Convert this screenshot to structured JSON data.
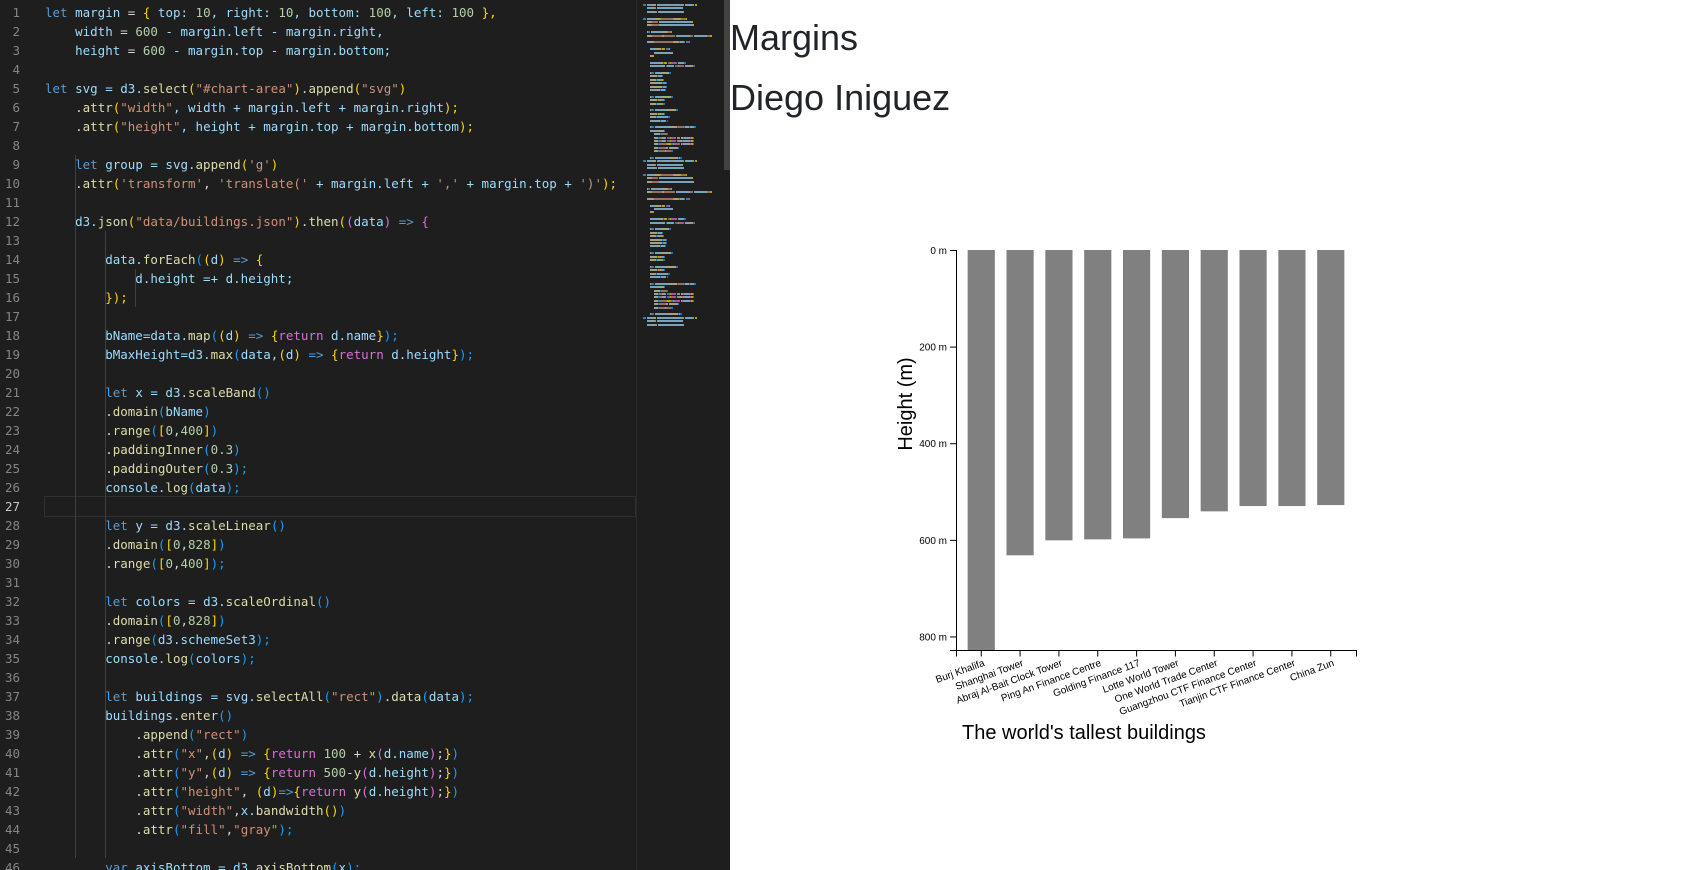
{
  "editor": {
    "active_line": 27,
    "lines": [
      [
        [
          "let",
          "kw"
        ],
        [
          " margin ",
          "vr"
        ],
        [
          "= ",
          "pn"
        ],
        [
          "{",
          "br1"
        ],
        [
          " top: ",
          "vr"
        ],
        [
          "10",
          "nm"
        ],
        [
          ", right: ",
          "vr"
        ],
        [
          "10",
          "nm"
        ],
        [
          ", bottom: ",
          "vr"
        ],
        [
          "100",
          "nm"
        ],
        [
          ", left: ",
          "vr"
        ],
        [
          "100",
          "nm"
        ],
        [
          " },",
          "br1"
        ]
      ],
      [
        [
          "    width ",
          "vr"
        ],
        [
          "= ",
          "pn"
        ],
        [
          "600",
          "nm"
        ],
        [
          " - margin.left - margin.right,",
          "vr"
        ]
      ],
      [
        [
          "    height ",
          "vr"
        ],
        [
          "= ",
          "pn"
        ],
        [
          "600",
          "nm"
        ],
        [
          " - margin.top - margin.bottom;",
          "vr"
        ]
      ],
      [],
      [
        [
          "let",
          "kw"
        ],
        [
          " svg ",
          "vr"
        ],
        [
          "= d3.",
          "vr"
        ],
        [
          "select",
          "fn"
        ],
        [
          "(",
          "br1"
        ],
        [
          "\"#chart-area\"",
          "st"
        ],
        [
          ")",
          "br1"
        ],
        [
          ".",
          "pn"
        ],
        [
          "append",
          "fn"
        ],
        [
          "(",
          "br1"
        ],
        [
          "\"svg\"",
          "st"
        ],
        [
          ")",
          "br1"
        ]
      ],
      [
        [
          "    .",
          "pn"
        ],
        [
          "attr",
          "fn"
        ],
        [
          "(",
          "br1"
        ],
        [
          "\"width\"",
          "st"
        ],
        [
          ", width + margin.left + margin.right",
          "vr"
        ],
        [
          ");",
          "br1"
        ]
      ],
      [
        [
          "    .",
          "pn"
        ],
        [
          "attr",
          "fn"
        ],
        [
          "(",
          "br1"
        ],
        [
          "\"height\"",
          "st"
        ],
        [
          ", height + margin.top + margin.bottom",
          "vr"
        ],
        [
          ");",
          "br1"
        ]
      ],
      [],
      [
        [
          "    ",
          "pn"
        ],
        [
          "let",
          "kw"
        ],
        [
          " group ",
          "vr"
        ],
        [
          "= svg.",
          "vr"
        ],
        [
          "append",
          "fn"
        ],
        [
          "(",
          "br1"
        ],
        [
          "'g'",
          "st"
        ],
        [
          ")",
          "br1"
        ]
      ],
      [
        [
          "    .",
          "pn"
        ],
        [
          "attr",
          "fn"
        ],
        [
          "(",
          "br1"
        ],
        [
          "'transform'",
          "st"
        ],
        [
          ", ",
          "pn"
        ],
        [
          "'translate('",
          "st"
        ],
        [
          " + margin.left + ",
          "vr"
        ],
        [
          "','",
          "st"
        ],
        [
          " + margin.top + ",
          "vr"
        ],
        [
          "')'",
          "st"
        ],
        [
          ");",
          "br1"
        ]
      ],
      [],
      [
        [
          "    d3.",
          "vr"
        ],
        [
          "json",
          "fn"
        ],
        [
          "(",
          "br1"
        ],
        [
          "\"data/buildings.json\"",
          "st"
        ],
        [
          ")",
          "br1"
        ],
        [
          ".",
          "pn"
        ],
        [
          "then",
          "fn"
        ],
        [
          "(",
          "br1"
        ],
        [
          "(",
          "br2"
        ],
        [
          "data",
          "vr"
        ],
        [
          ")",
          "br2"
        ],
        [
          " => ",
          "ar"
        ],
        [
          "{",
          "br2"
        ]
      ],
      [],
      [
        [
          "        data.",
          "vr"
        ],
        [
          "forEach",
          "fn"
        ],
        [
          "(",
          "br3"
        ],
        [
          "(",
          "br1"
        ],
        [
          "d",
          "vr"
        ],
        [
          ")",
          "br1"
        ],
        [
          " => ",
          "ar"
        ],
        [
          "{",
          "br1"
        ]
      ],
      [
        [
          "            d.height =+ d.height;",
          "vr"
        ]
      ],
      [
        [
          "        ",
          "pn"
        ],
        [
          "});",
          "br1"
        ]
      ],
      [],
      [
        [
          "        bName",
          "vr"
        ],
        [
          "=data.",
          "vr"
        ],
        [
          "map",
          "fn"
        ],
        [
          "(",
          "br3"
        ],
        [
          "(",
          "br1"
        ],
        [
          "d",
          "vr"
        ],
        [
          ")",
          "br1"
        ],
        [
          " => ",
          "ar"
        ],
        [
          "{",
          "br1"
        ],
        [
          "return",
          "br2"
        ],
        [
          " d.name",
          "vr"
        ],
        [
          "}",
          "br1"
        ],
        [
          ");",
          "br3"
        ]
      ],
      [
        [
          "        bMaxHeight",
          "vr"
        ],
        [
          "=d3.",
          "vr"
        ],
        [
          "max",
          "fn"
        ],
        [
          "(",
          "br3"
        ],
        [
          "data,",
          "vr"
        ],
        [
          "(",
          "br1"
        ],
        [
          "d",
          "vr"
        ],
        [
          ")",
          "br1"
        ],
        [
          " => ",
          "ar"
        ],
        [
          "{",
          "br1"
        ],
        [
          "return",
          "br2"
        ],
        [
          " d.height",
          "vr"
        ],
        [
          "}",
          "br1"
        ],
        [
          ");",
          "br3"
        ]
      ],
      [],
      [
        [
          "        ",
          "pn"
        ],
        [
          "let",
          "kw"
        ],
        [
          " x ",
          "vr"
        ],
        [
          "= d3.",
          "vr"
        ],
        [
          "scaleBand",
          "fn"
        ],
        [
          "()",
          "br3"
        ]
      ],
      [
        [
          "        .",
          "pn"
        ],
        [
          "domain",
          "fn"
        ],
        [
          "(",
          "br3"
        ],
        [
          "bName",
          "vr"
        ],
        [
          ")",
          "br3"
        ]
      ],
      [
        [
          "        .",
          "pn"
        ],
        [
          "range",
          "fn"
        ],
        [
          "(",
          "br3"
        ],
        [
          "[",
          "br1"
        ],
        [
          "0",
          "nm"
        ],
        [
          ",",
          "pn"
        ],
        [
          "400",
          "nm"
        ],
        [
          "]",
          "br1"
        ],
        [
          ")",
          "br3"
        ]
      ],
      [
        [
          "        .",
          "pn"
        ],
        [
          "paddingInner",
          "fn"
        ],
        [
          "(",
          "br3"
        ],
        [
          "0.3",
          "nm"
        ],
        [
          ")",
          "br3"
        ]
      ],
      [
        [
          "        .",
          "pn"
        ],
        [
          "paddingOuter",
          "fn"
        ],
        [
          "(",
          "br3"
        ],
        [
          "0.3",
          "nm"
        ],
        [
          ");",
          "br3"
        ]
      ],
      [
        [
          "        console.",
          "vr"
        ],
        [
          "log",
          "fn"
        ],
        [
          "(",
          "br3"
        ],
        [
          "data",
          "vr"
        ],
        [
          ");",
          "br3"
        ]
      ],
      [],
      [
        [
          "        ",
          "pn"
        ],
        [
          "let",
          "kw"
        ],
        [
          " y ",
          "vr"
        ],
        [
          "= d3.",
          "vr"
        ],
        [
          "scaleLinear",
          "fn"
        ],
        [
          "()",
          "br3"
        ]
      ],
      [
        [
          "        .",
          "pn"
        ],
        [
          "domain",
          "fn"
        ],
        [
          "(",
          "br3"
        ],
        [
          "[",
          "br1"
        ],
        [
          "0",
          "nm"
        ],
        [
          ",",
          "pn"
        ],
        [
          "828",
          "nm"
        ],
        [
          "]",
          "br1"
        ],
        [
          ")",
          "br3"
        ]
      ],
      [
        [
          "        .",
          "pn"
        ],
        [
          "range",
          "fn"
        ],
        [
          "(",
          "br3"
        ],
        [
          "[",
          "br1"
        ],
        [
          "0",
          "nm"
        ],
        [
          ",",
          "pn"
        ],
        [
          "400",
          "nm"
        ],
        [
          "]",
          "br1"
        ],
        [
          ");",
          "br3"
        ]
      ],
      [],
      [
        [
          "        ",
          "pn"
        ],
        [
          "let",
          "kw"
        ],
        [
          " colors ",
          "vr"
        ],
        [
          "= d3.",
          "vr"
        ],
        [
          "scaleOrdinal",
          "fn"
        ],
        [
          "()",
          "br3"
        ]
      ],
      [
        [
          "        .",
          "pn"
        ],
        [
          "domain",
          "fn"
        ],
        [
          "(",
          "br3"
        ],
        [
          "[",
          "br1"
        ],
        [
          "0",
          "nm"
        ],
        [
          ",",
          "pn"
        ],
        [
          "828",
          "nm"
        ],
        [
          "]",
          "br1"
        ],
        [
          ")",
          "br3"
        ]
      ],
      [
        [
          "        .",
          "pn"
        ],
        [
          "range",
          "fn"
        ],
        [
          "(",
          "br3"
        ],
        [
          "d3.schemeSet3",
          "vr"
        ],
        [
          ");",
          "br3"
        ]
      ],
      [
        [
          "        console.",
          "vr"
        ],
        [
          "log",
          "fn"
        ],
        [
          "(",
          "br3"
        ],
        [
          "colors",
          "vr"
        ],
        [
          ");",
          "br3"
        ]
      ],
      [],
      [
        [
          "        ",
          "pn"
        ],
        [
          "let",
          "kw"
        ],
        [
          " buildings ",
          "vr"
        ],
        [
          "= svg.",
          "vr"
        ],
        [
          "selectAll",
          "fn"
        ],
        [
          "(",
          "br3"
        ],
        [
          "\"rect\"",
          "st"
        ],
        [
          ")",
          "br3"
        ],
        [
          ".",
          "pn"
        ],
        [
          "data",
          "fn"
        ],
        [
          "(",
          "br3"
        ],
        [
          "data",
          "vr"
        ],
        [
          ");",
          "br3"
        ]
      ],
      [
        [
          "        buildings.",
          "vr"
        ],
        [
          "enter",
          "fn"
        ],
        [
          "()",
          "br3"
        ]
      ],
      [
        [
          "            .",
          "pn"
        ],
        [
          "append",
          "fn"
        ],
        [
          "(",
          "br3"
        ],
        [
          "\"rect\"",
          "st"
        ],
        [
          ")",
          "br3"
        ]
      ],
      [
        [
          "            .",
          "pn"
        ],
        [
          "attr",
          "fn"
        ],
        [
          "(",
          "br3"
        ],
        [
          "\"x\"",
          "st"
        ],
        [
          ",",
          "pn"
        ],
        [
          "(",
          "br1"
        ],
        [
          "d",
          "vr"
        ],
        [
          ")",
          "br1"
        ],
        [
          " => ",
          "ar"
        ],
        [
          "{",
          "br1"
        ],
        [
          "return",
          "br2"
        ],
        [
          " 100",
          "nm"
        ],
        [
          " + ",
          "pn"
        ],
        [
          "x",
          "fn"
        ],
        [
          "(",
          "br2"
        ],
        [
          "d.name",
          "vr"
        ],
        [
          ")",
          "br2"
        ],
        [
          ";",
          "pn"
        ],
        [
          "}",
          "br1"
        ],
        [
          ")",
          "br3"
        ]
      ],
      [
        [
          "            .",
          "pn"
        ],
        [
          "attr",
          "fn"
        ],
        [
          "(",
          "br3"
        ],
        [
          "\"y\"",
          "st"
        ],
        [
          ",",
          "pn"
        ],
        [
          "(",
          "br1"
        ],
        [
          "d",
          "vr"
        ],
        [
          ")",
          "br1"
        ],
        [
          " => ",
          "ar"
        ],
        [
          "{",
          "br1"
        ],
        [
          "return",
          "br2"
        ],
        [
          " 500",
          "nm"
        ],
        [
          "-",
          "pn"
        ],
        [
          "y",
          "fn"
        ],
        [
          "(",
          "br2"
        ],
        [
          "d.height",
          "vr"
        ],
        [
          ")",
          "br2"
        ],
        [
          ";",
          "pn"
        ],
        [
          "}",
          "br1"
        ],
        [
          ")",
          "br3"
        ]
      ],
      [
        [
          "            .",
          "pn"
        ],
        [
          "attr",
          "fn"
        ],
        [
          "(",
          "br3"
        ],
        [
          "\"height\"",
          "st"
        ],
        [
          ", ",
          "pn"
        ],
        [
          "(",
          "br1"
        ],
        [
          "d",
          "vr"
        ],
        [
          ")",
          "br1"
        ],
        [
          "=>",
          "ar"
        ],
        [
          "{",
          "br1"
        ],
        [
          "return",
          "br2"
        ],
        [
          " y",
          "fn"
        ],
        [
          "(",
          "br2"
        ],
        [
          "d.height",
          "vr"
        ],
        [
          ")",
          "br2"
        ],
        [
          ";",
          "pn"
        ],
        [
          "}",
          "br1"
        ],
        [
          ")",
          "br3"
        ]
      ],
      [
        [
          "            .",
          "pn"
        ],
        [
          "attr",
          "fn"
        ],
        [
          "(",
          "br3"
        ],
        [
          "\"width\"",
          "st"
        ],
        [
          ",",
          "pn"
        ],
        [
          "x.",
          "vr"
        ],
        [
          "bandwidth",
          "fn"
        ],
        [
          "()",
          "br1"
        ],
        [
          ")",
          "br3"
        ]
      ],
      [
        [
          "            .",
          "pn"
        ],
        [
          "attr",
          "fn"
        ],
        [
          "(",
          "br3"
        ],
        [
          "\"fill\"",
          "st"
        ],
        [
          ",",
          "pn"
        ],
        [
          "\"gray\"",
          "st"
        ],
        [
          ");",
          "br3"
        ]
      ],
      [],
      [
        [
          "        ",
          "pn"
        ],
        [
          "var",
          "kw"
        ],
        [
          " axisBottom ",
          "vr"
        ],
        [
          "= d3.",
          "vr"
        ],
        [
          "axisBottom",
          "fn"
        ],
        [
          "(",
          "br3"
        ],
        [
          "x",
          "vr"
        ],
        [
          ");",
          "br3"
        ]
      ]
    ]
  },
  "page": {
    "title": "Margins",
    "author": "Diego Iniguez"
  },
  "colors": {
    "bar": "#808080",
    "editor_bg": "#1e1e1e"
  },
  "chart_data": {
    "type": "bar",
    "title": "The world's tallest buildings",
    "xlabel": "The world's tallest buildings",
    "ylabel": "Height (m)",
    "ylim": [
      0,
      828
    ],
    "y_inverted": true,
    "yticks": [
      0,
      200,
      400,
      600,
      800
    ],
    "ytick_suffix": " m",
    "categories": [
      "Burj Khalifa",
      "Shanghai Tower",
      "Abraj Al-Bait Clock Tower",
      "Ping An Finance Centre",
      "Golding Finance 117",
      "Lotte World Tower",
      "One World Trade Center",
      "Guangzhou CTF Finance Center",
      "Tianjin CTF Finance Center",
      "China Zun"
    ],
    "values": [
      828,
      632,
      601,
      599,
      597,
      555,
      541,
      530,
      530,
      528
    ]
  }
}
